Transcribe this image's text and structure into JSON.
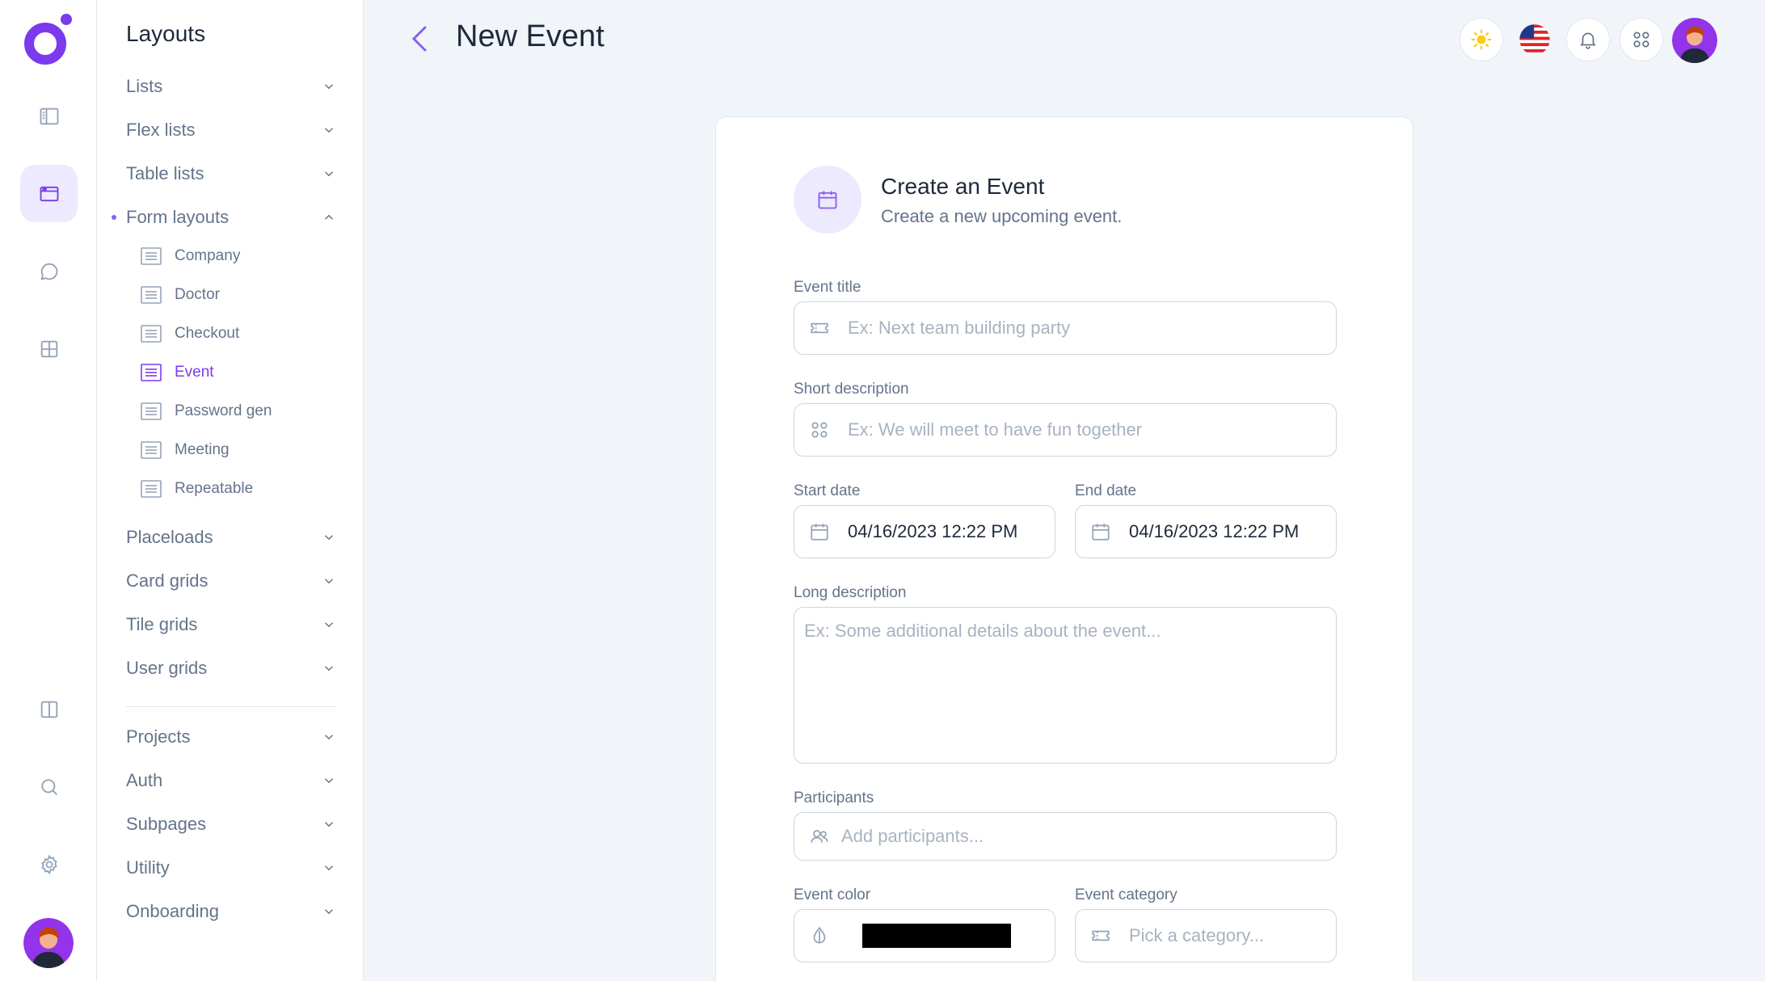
{
  "app": {
    "page_title": "New Event"
  },
  "subnav": {
    "title": "Layouts",
    "groups": [
      {
        "label": "Lists"
      },
      {
        "label": "Flex lists"
      },
      {
        "label": "Table lists"
      },
      {
        "label": "Form layouts"
      },
      {
        "label": "Placeloads"
      },
      {
        "label": "Card grids"
      },
      {
        "label": "Tile grids"
      },
      {
        "label": "User grids"
      },
      {
        "label": "Projects"
      },
      {
        "label": "Auth"
      },
      {
        "label": "Subpages"
      },
      {
        "label": "Utility"
      },
      {
        "label": "Onboarding"
      }
    ],
    "form_layouts": [
      {
        "label": "Company"
      },
      {
        "label": "Doctor"
      },
      {
        "label": "Checkout"
      },
      {
        "label": "Event",
        "active": true
      },
      {
        "label": "Password gen"
      },
      {
        "label": "Meeting"
      },
      {
        "label": "Repeatable"
      }
    ]
  },
  "form": {
    "header_title": "Create an Event",
    "header_subtitle": "Create a new upcoming event.",
    "event_title_label": "Event title",
    "event_title_placeholder": "Ex: Next team building party",
    "short_desc_label": "Short description",
    "short_desc_placeholder": "Ex: We will meet to have fun together",
    "start_date_label": "Start date",
    "start_date_value": "04/16/2023 12:22 PM",
    "end_date_label": "End date",
    "end_date_value": "04/16/2023 12:22 PM",
    "long_desc_label": "Long description",
    "long_desc_placeholder": "Ex: Some additional details about the event...",
    "participants_label": "Participants",
    "participants_placeholder": "Add participants...",
    "event_color_label": "Event color",
    "event_color_value": "#000000",
    "event_category_label": "Event category",
    "event_category_placeholder": "Pick a category..."
  },
  "colors": {
    "accent": "#8b5cf6",
    "accent_light": "#ede9fe",
    "background": "#f1f5f9"
  }
}
